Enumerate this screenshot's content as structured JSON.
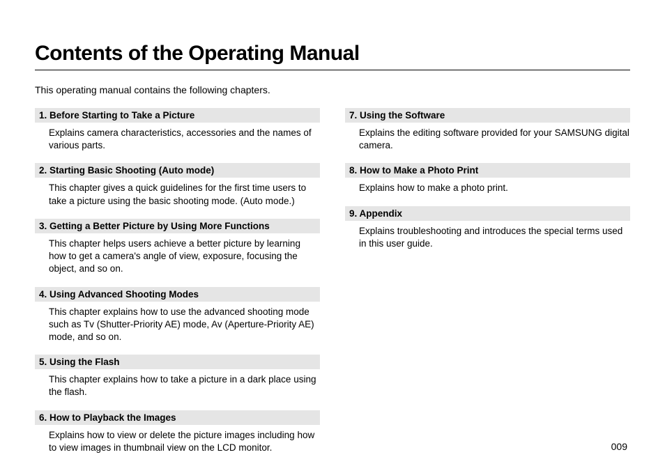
{
  "title": "Contents of the Operating Manual",
  "intro": "This operating manual contains the following chapters.",
  "left_sections": [
    {
      "header": "1. Before Starting to Take a Picture",
      "body": "Explains camera characteristics, accessories and the names of various parts."
    },
    {
      "header": "2. Starting Basic Shooting (Auto mode)",
      "body": "This chapter gives a quick guidelines for the first time users to take a picture using the basic shooting mode. (Auto mode.)"
    },
    {
      "header": "3. Getting a Better Picture by Using More Functions",
      "body": "This chapter helps users achieve a better picture by learning how to get a camera's angle of view, exposure, focusing the object, and so on."
    },
    {
      "header": "4. Using Advanced Shooting Modes",
      "body": "This chapter explains how to use the advanced shooting mode such as Tv (Shutter-Priority AE) mode, Av (Aperture-Priority AE) mode, and so on."
    },
    {
      "header": "5. Using the Flash",
      "body": "This chapter explains how to take a picture in a dark place using the flash."
    },
    {
      "header": "6. How to Playback the Images",
      "body": "Explains how to view or delete the picture images including how to view images in thumbnail view on the LCD monitor."
    }
  ],
  "right_sections": [
    {
      "header": "7. Using the Software",
      "body": "Explains the editing software provided for your SAMSUNG digital camera."
    },
    {
      "header": "8. How to Make a Photo Print",
      "body": "Explains how to make a photo print."
    },
    {
      "header": "9. Appendix",
      "body": "Explains troubleshooting and introduces the special terms used in this user guide."
    }
  ],
  "page_number": "009"
}
